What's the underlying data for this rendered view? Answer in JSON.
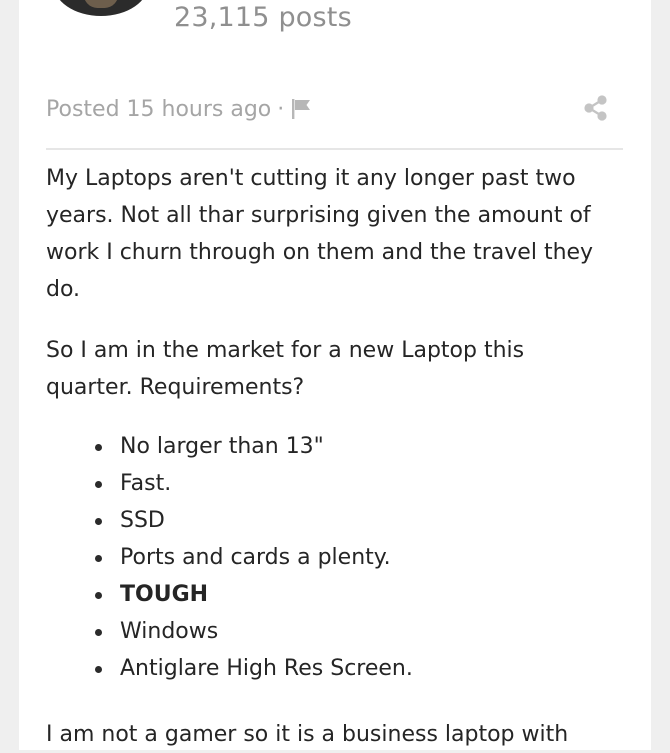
{
  "author": {
    "post_count": "23,115 posts"
  },
  "post_meta": {
    "posted_label": "Posted 15 hours ago",
    "separator": "·",
    "icons": {
      "report": "flag-icon",
      "share": "share-icon"
    }
  },
  "post_body": {
    "paragraph_1": "My Laptops aren't cutting it any longer past two years. Not all thar surprising given the amount of work I churn through on them and the travel they do.",
    "paragraph_2": "So I am in the market for a new Laptop this quarter. Requirements?",
    "requirements": [
      "No larger than 13\"",
      "Fast.",
      "SSD",
      "Ports and cards a plenty.",
      "TOUGH",
      "Windows",
      "Antiglare High Res Screen."
    ],
    "paragraph_3": "I am not a gamer so it is a business laptop with"
  },
  "colors": {
    "page_bg": "#efefef",
    "card_bg": "#ffffff",
    "muted_text": "#a5a5a5",
    "body_text": "#252525"
  }
}
